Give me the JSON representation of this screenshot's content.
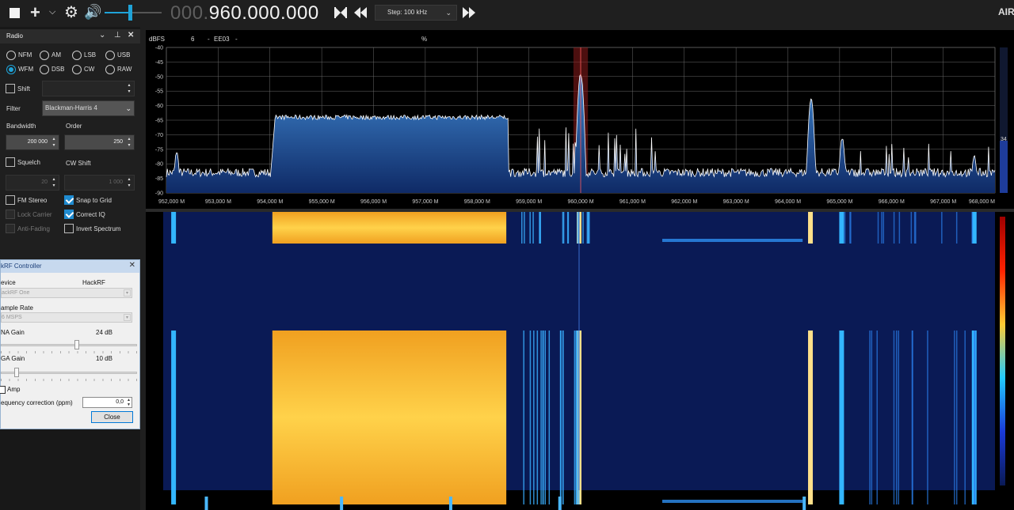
{
  "toolbar": {
    "freq_dim": "000.",
    "freq_main": "960.000.000",
    "step_label": "Step: 100 kHz",
    "logo_text": "AIR"
  },
  "colors": {
    "accent": "#1fa3d8",
    "check_blue": "#1f8bd0",
    "spectrum_fill": "#2f6cb4",
    "spectrum_line": "#ffffff",
    "waterfall_bg": "#0a1a55",
    "grid": "#6a6a6a"
  },
  "volume": {
    "level": 0.45
  },
  "radio_panel": {
    "title": "Radio",
    "modes": [
      "NFM",
      "AM",
      "LSB",
      "USB",
      "WFM",
      "DSB",
      "CW",
      "RAW"
    ],
    "selected_mode": "WFM",
    "shift_label": "Shift",
    "filter_label": "Filter",
    "filter_value": "Blackman-Harris 4",
    "bandwidth_label": "Bandwidth",
    "bandwidth_value": "200 000",
    "order_label": "Order",
    "order_value": "250",
    "squelch_label": "Squelch",
    "cw_shift_label": "CW Shift",
    "squelch_value": "20",
    "cw_shift_value": "1 000",
    "fm_stereo_label": "FM Stereo",
    "snap_to_grid_label": "Snap to Grid",
    "lock_carrier_label": "Lock Carrier",
    "correct_iq_label": "Correct IQ",
    "anti_fading_label": "Anti-Fading",
    "invert_spectrum_label": "Invert Spectrum"
  },
  "hackrf": {
    "title": "kRF Controller",
    "device_label": "evice",
    "device_name": "HackRF",
    "device_value": "ackRF One",
    "sample_rate_label": "ample Rate",
    "sample_rate_value": "6 MSPS",
    "lna_label": "NA Gain",
    "lna_value": "24 dB",
    "lna_level": 0.56,
    "vga_label": "GA Gain",
    "vga_value": "10 dB",
    "vga_level": 0.1,
    "amp_label": "Amp",
    "ppm_label": "equency correction (ppm)",
    "ppm_value": "0,0",
    "close_label": "Close"
  },
  "spectrum_header": {
    "dbfs_label": "dBFS",
    "value_1": "6",
    "value_2": "-",
    "value_3": "EE03",
    "value_4": "-",
    "percent_label": "%"
  },
  "chart_data": {
    "type": "line",
    "title": "",
    "xlabel": "",
    "ylabel": "dBFS",
    "xlim": [
      952000000,
      968000000
    ],
    "ylim": [
      -90,
      -40
    ],
    "x_ticks": [
      "952,000 M",
      "953,000 M",
      "954,000 M",
      "955,000 M",
      "956,000 M",
      "957,000 M",
      "958,000 M",
      "959,000 M",
      "960,000 M",
      "961,000 M",
      "962,000 M",
      "963,000 M",
      "964,000 M",
      "965,000 M",
      "966,000 M",
      "967,000 M",
      "968,000 M"
    ],
    "y_ticks": [
      "-40",
      "-45",
      "-50",
      "-55",
      "-60",
      "-65",
      "-70",
      "-75",
      "-80",
      "-85",
      "-90"
    ],
    "noise_floor_db": -83,
    "center_freq": 960000000,
    "filter_bandwidth_hz": 200000,
    "level_indicator": "34",
    "signals": [
      {
        "label": "",
        "f_start_mhz": 954.1,
        "f_end_mhz": 958.6,
        "level_db": -64
      },
      {
        "label": "",
        "f_mhz": 952.2,
        "level_db": -76
      },
      {
        "label": "",
        "f_mhz": 960.0,
        "level_db": -49
      },
      {
        "label": "",
        "f_mhz": 964.45,
        "level_db": -58
      },
      {
        "label": "",
        "f_mhz": 965.05,
        "level_db": -71
      },
      {
        "label": "",
        "f_mhz": 967.6,
        "level_db": -77
      }
    ]
  }
}
